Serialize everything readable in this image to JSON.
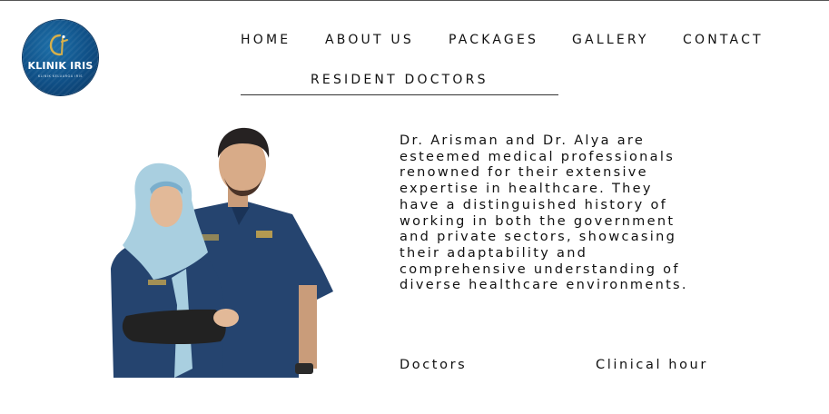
{
  "brand": {
    "name": "KLINIK IRIS",
    "tagline": "KLINIK KELUARGA IRIS",
    "colors": {
      "logo_background": "#0f4f86",
      "logo_accent": "#d8b04a"
    }
  },
  "nav": {
    "items": [
      {
        "label": "HOME"
      },
      {
        "label": "ABOUT US"
      },
      {
        "label": "PACKAGES"
      },
      {
        "label": "GALLERY"
      },
      {
        "label": "CONTACT"
      }
    ],
    "second_row": {
      "label": "RESIDENT DOCTORS"
    }
  },
  "about": {
    "description_lines": [
      "Dr. Arisman and Dr. Alya are",
      "esteemed medical professionals",
      "renowned for their extensive",
      "expertise in healthcare. They",
      "have a distinguished history of",
      "working in both the government",
      "and private sectors, showcasing",
      "their adaptability and",
      "comprehensive understanding of",
      "diverse healthcare environments."
    ]
  },
  "tabs": {
    "doctors": "Doctors",
    "clinical_hour": "Clinical hour"
  },
  "photo": {
    "scrub_color": "#25446f",
    "hijab_color": "#a9cfe0"
  }
}
